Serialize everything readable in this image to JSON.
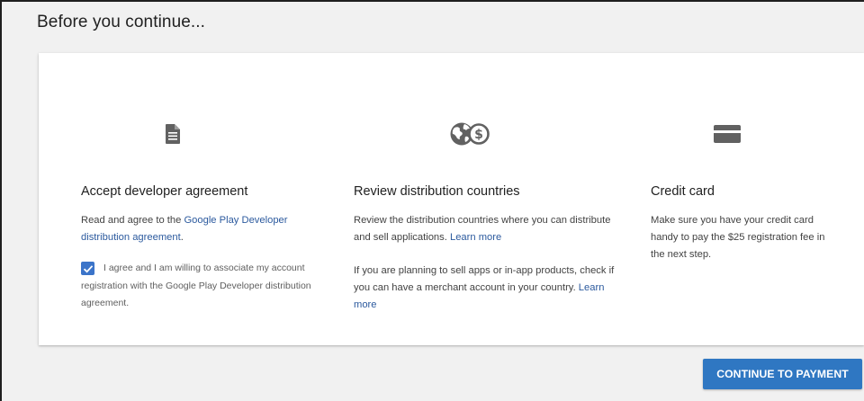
{
  "header": {
    "title": "Before you continue..."
  },
  "columns": {
    "agreement": {
      "icon": "document-icon",
      "title": "Accept developer agreement",
      "text_prefix": "Read and agree to the ",
      "link": "Google Play Developer distribution agreement",
      "text_suffix": ".",
      "checkbox_checked": true,
      "checkbox_label": "I agree and I am willing to associate my account registration with the Google Play Developer distribution agreement."
    },
    "countries": {
      "icon": "globe-dollar-icon",
      "title": "Review distribution countries",
      "p1_text": "Review the distribution countries where you can distribute and sell applications. ",
      "p1_link": "Learn more",
      "p2_text": "If you are planning to sell apps or in-app products, check if you can have a merchant account in your country. ",
      "p2_link": "Learn more"
    },
    "credit": {
      "icon": "credit-card-icon",
      "title": "Credit card",
      "text": "Make sure you have your credit card handy to pay the $25 registration fee in the next step."
    }
  },
  "footer": {
    "continue_label": "CONTINUE TO PAYMENT"
  },
  "colors": {
    "accent": "#2f77c2",
    "link": "#2c5a9e",
    "checkbox": "#3b74c9",
    "icon": "#616161",
    "background": "#f1f1f1"
  }
}
